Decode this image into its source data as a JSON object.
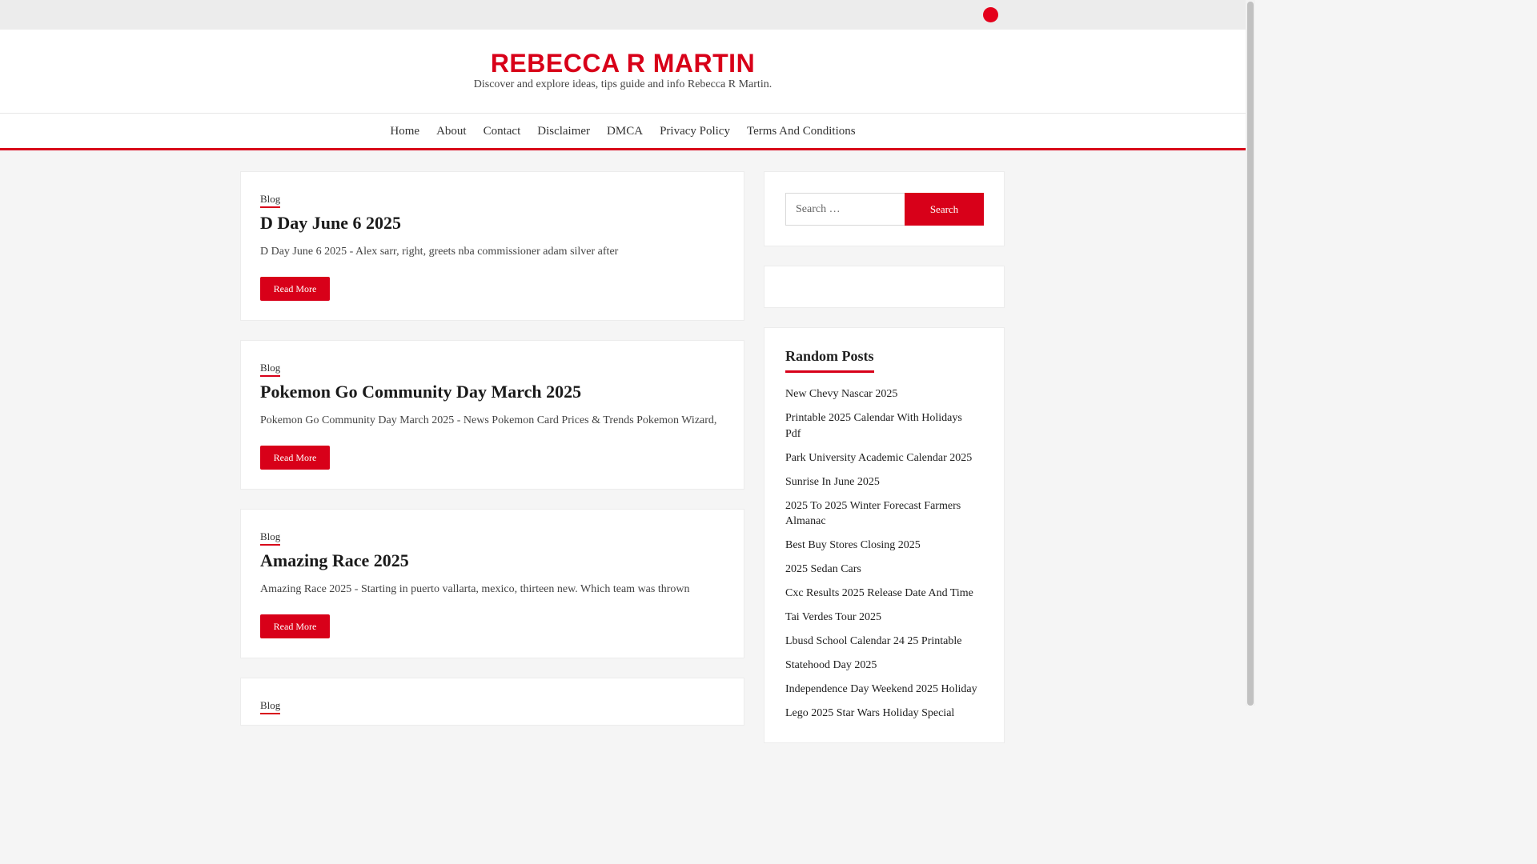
{
  "site": {
    "title": "REBECCA R MARTIN",
    "tagline": "Discover and explore ideas, tips guide and info Rebecca R Martin."
  },
  "nav": {
    "items": [
      {
        "label": "Home"
      },
      {
        "label": "About"
      },
      {
        "label": "Contact"
      },
      {
        "label": "Disclaimer"
      },
      {
        "label": "DMCA"
      },
      {
        "label": "Privacy Policy"
      },
      {
        "label": "Terms And Conditions"
      }
    ]
  },
  "posts": [
    {
      "category": "Blog",
      "title": "D Day June 6 2025",
      "excerpt": "D Day June 6 2025 - Alex sarr, right, greets nba commissioner adam silver after",
      "button": "Read More"
    },
    {
      "category": "Blog",
      "title": "Pokemon Go Community Day March 2025",
      "excerpt": "Pokemon Go Community Day March 2025 - News Pokemon Card Prices & Trends Pokemon Wizard,",
      "button": "Read More"
    },
    {
      "category": "Blog",
      "title": "Amazing Race 2025",
      "excerpt": "Amazing Race 2025 - Starting in puerto vallarta, mexico, thirteen new. Which team was thrown",
      "button": "Read More"
    },
    {
      "category": "Blog"
    }
  ],
  "sidebar": {
    "search": {
      "placeholder": "Search …",
      "button": "Search"
    },
    "random_posts": {
      "title": "Random Posts",
      "items": [
        "New Chevy Nascar 2025",
        "Printable 2025 Calendar With Holidays Pdf",
        "Park University Academic Calendar 2025",
        "Sunrise In June 2025",
        "2025 To 2025 Winter Forecast Farmers Almanac",
        "Best Buy Stores Closing 2025",
        "2025 Sedan Cars",
        "Cxc Results 2025 Release Date And Time",
        "Tai Verdes Tour 2025",
        "Lbusd School Calendar 24 25 Printable",
        "Statehood Day 2025",
        "Independence Day Weekend 2025 Holiday",
        "Lego 2025 Star Wars Holiday Special"
      ]
    }
  },
  "colors": {
    "accent": "#d80019",
    "background": "#f5f5f5"
  },
  "icons": {
    "header_search": "search-icon"
  }
}
